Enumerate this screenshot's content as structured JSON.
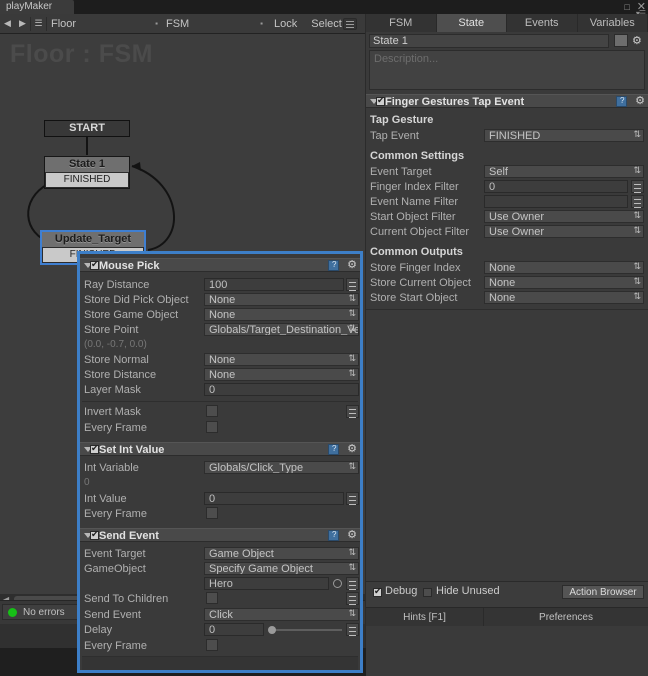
{
  "window": {
    "tab_label": "playMaker",
    "minimize_icon": "minimize-icon",
    "close_icon": "close-icon",
    "menu_icon": "window-menu-icon"
  },
  "toolbar": {
    "back_icon": "back-arrow-icon",
    "forward_icon": "forward-arrow-icon",
    "menu_icon": "hamburger-menu-icon",
    "owner_dropdown": "Floor",
    "fsm_dropdown": "FSM",
    "lock_label": "Lock",
    "select_label": "Select",
    "list_icon": "list-view-icon"
  },
  "graph": {
    "title": "Floor : FSM",
    "start_node": "START",
    "nodes": [
      {
        "name": "State 1",
        "transition": "FINISHED",
        "selected": false
      },
      {
        "name": "Update_Target",
        "transition": "FINISHED",
        "selected": true
      }
    ],
    "status": "No errors",
    "status_color": "#17c017"
  },
  "inspector": {
    "tabs": [
      {
        "label": "FSM",
        "active": false
      },
      {
        "label": "State",
        "active": true
      },
      {
        "label": "Events",
        "active": false
      },
      {
        "label": "Variables",
        "active": false
      }
    ],
    "state_name": "State 1",
    "description_placeholder": "Description...",
    "color_swatch": "#6d6d6d",
    "gear_icon": "gear-icon",
    "action": {
      "title": "Finger Gestures Tap Event",
      "enabled": true,
      "help_icon": "help-book-icon",
      "gear_icon": "gear-icon",
      "groups": [
        {
          "header": "Tap Gesture",
          "fields": [
            {
              "label": "Tap Event",
              "value": "FINISHED",
              "type": "dropdown"
            }
          ]
        },
        {
          "header": "Common Settings",
          "fields": [
            {
              "label": "Event Target",
              "value": "Self",
              "type": "dropdown"
            },
            {
              "label": "Finger Index Filter",
              "value": "0",
              "type": "field-eq"
            },
            {
              "label": "Event Name Filter",
              "value": "",
              "type": "field-eq"
            },
            {
              "label": "Start Object Filter",
              "value": "Use Owner",
              "type": "dropdown"
            },
            {
              "label": "Current Object Filter",
              "value": "Use Owner",
              "type": "dropdown"
            }
          ]
        },
        {
          "header": "Common Outputs",
          "fields": [
            {
              "label": "Store Finger Index",
              "value": "None",
              "type": "dropdown"
            },
            {
              "label": "Store Current Object",
              "value": "None",
              "type": "dropdown"
            },
            {
              "label": "Store Start Object",
              "value": "None",
              "type": "dropdown"
            }
          ]
        }
      ]
    },
    "footer": {
      "debug_label": "Debug",
      "debug_checked": true,
      "hide_unused_label": "Hide Unused",
      "hide_unused_checked": false,
      "action_browser_label": "Action Browser",
      "hints_label": "Hints [F1]",
      "preferences_label": "Preferences"
    }
  },
  "action_panel": {
    "border_color": "#3d7fc8",
    "actions": [
      {
        "title": "Mouse Pick",
        "enabled": true,
        "help_icon": "help-book-icon",
        "gear_icon": "gear-icon",
        "fields": [
          {
            "label": "Ray Distance",
            "value": "100",
            "type": "field-eq"
          },
          {
            "label": "Store Did Pick Object",
            "value": "None",
            "type": "dropdown"
          },
          {
            "label": "Store Game Object",
            "value": "None",
            "type": "dropdown"
          },
          {
            "label": "Store Point",
            "value": "Globals/Target_Destination_Vecto",
            "type": "dropdown"
          },
          {
            "label": "",
            "value": "(0.0, -0.7, 0.0)",
            "type": "readonly"
          },
          {
            "label": "Store Normal",
            "value": "None",
            "type": "dropdown"
          },
          {
            "label": "Store Distance",
            "value": "None",
            "type": "dropdown"
          },
          {
            "label": "Layer Mask",
            "value": "0",
            "type": "field"
          },
          {
            "label": "Invert Mask",
            "value": "",
            "type": "checkbox-eq"
          },
          {
            "label": "Every Frame",
            "value": "",
            "type": "checkbox"
          }
        ]
      },
      {
        "title": "Set Int Value",
        "enabled": true,
        "help_icon": "help-book-icon",
        "gear_icon": "gear-icon",
        "fields": [
          {
            "label": "Int Variable",
            "value": "Globals/Click_Type",
            "type": "dropdown"
          },
          {
            "label": "",
            "value": "0",
            "type": "readonly"
          },
          {
            "label": "Int Value",
            "value": "0",
            "type": "field-eq"
          },
          {
            "label": "Every Frame",
            "value": "",
            "type": "checkbox"
          }
        ]
      },
      {
        "title": "Send Event",
        "enabled": true,
        "help_icon": "help-book-icon",
        "gear_icon": "gear-icon",
        "fields": [
          {
            "label": "Event Target",
            "value": "Game Object",
            "type": "dropdown"
          },
          {
            "label": "GameObject",
            "value": "Specify Game Object",
            "type": "dropdown"
          },
          {
            "label": "",
            "value": "Hero",
            "type": "object-field"
          },
          {
            "label": "Send To Children",
            "value": "",
            "type": "checkbox-eq"
          },
          {
            "label": "Send Event",
            "value": "Click",
            "type": "dropdown"
          },
          {
            "label": "Delay",
            "value": "0",
            "type": "slider-eq"
          },
          {
            "label": "Every Frame",
            "value": "",
            "type": "checkbox"
          }
        ]
      }
    ]
  }
}
